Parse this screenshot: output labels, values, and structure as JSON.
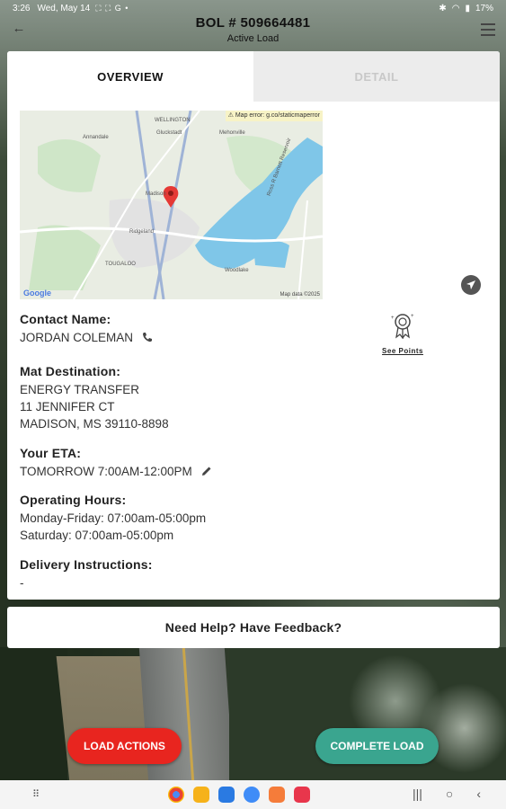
{
  "status_bar": {
    "time": "3:26",
    "date": "Wed, May 14",
    "notifications": "⛶ ⛶ G •",
    "battery": "17%"
  },
  "header": {
    "title": "BOL # 509664481",
    "subtitle": "Active Load"
  },
  "tabs": [
    {
      "label": "OVERVIEW",
      "active": true
    },
    {
      "label": "DETAIL",
      "active": false
    }
  ],
  "map": {
    "error_text": "⚠ Map error: g.co/staticmaperror",
    "google_label": "Google",
    "data_label": "Map data ©2025",
    "places": [
      "WELLINGTON",
      "Gluckstadt",
      "Mehonville",
      "Annandale",
      "Madison",
      "Ridgeland",
      "Woodlake",
      "Ross R Barnett Reservoir",
      "TOUGALOO"
    ]
  },
  "contact": {
    "label": "Contact Name:",
    "name": "JORDAN COLEMAN"
  },
  "points": {
    "label": "See Points"
  },
  "destination": {
    "label": "Mat Destination:",
    "line1": "ENERGY TRANSFER",
    "line2": "11 JENNIFER CT",
    "line3": "MADISON, MS 39110-8898"
  },
  "eta": {
    "label": "Your ETA:",
    "value": "TOMORROW 7:00AM-12:00PM"
  },
  "hours": {
    "label": "Operating Hours:",
    "line1": "Monday-Friday: 07:00am-05:00pm",
    "line2": "Saturday: 07:00am-05:00pm"
  },
  "delivery": {
    "label": "Delivery Instructions:",
    "value": "-"
  },
  "help": {
    "label": "Need Help? Have Feedback?"
  },
  "actions": {
    "load_actions": "LOAD ACTIONS",
    "complete_load": "COMPLETE LOAD"
  },
  "colors": {
    "load_actions": "#e8251f",
    "complete_load": "#3aa58f",
    "map_pin": "#e53935",
    "water": "#7fc6e8"
  },
  "navbar": {
    "apps": [
      "chrome-icon",
      "notes-icon",
      "calendar-icon",
      "messages-icon",
      "contacts-icon",
      "screen-recorder-icon"
    ]
  }
}
